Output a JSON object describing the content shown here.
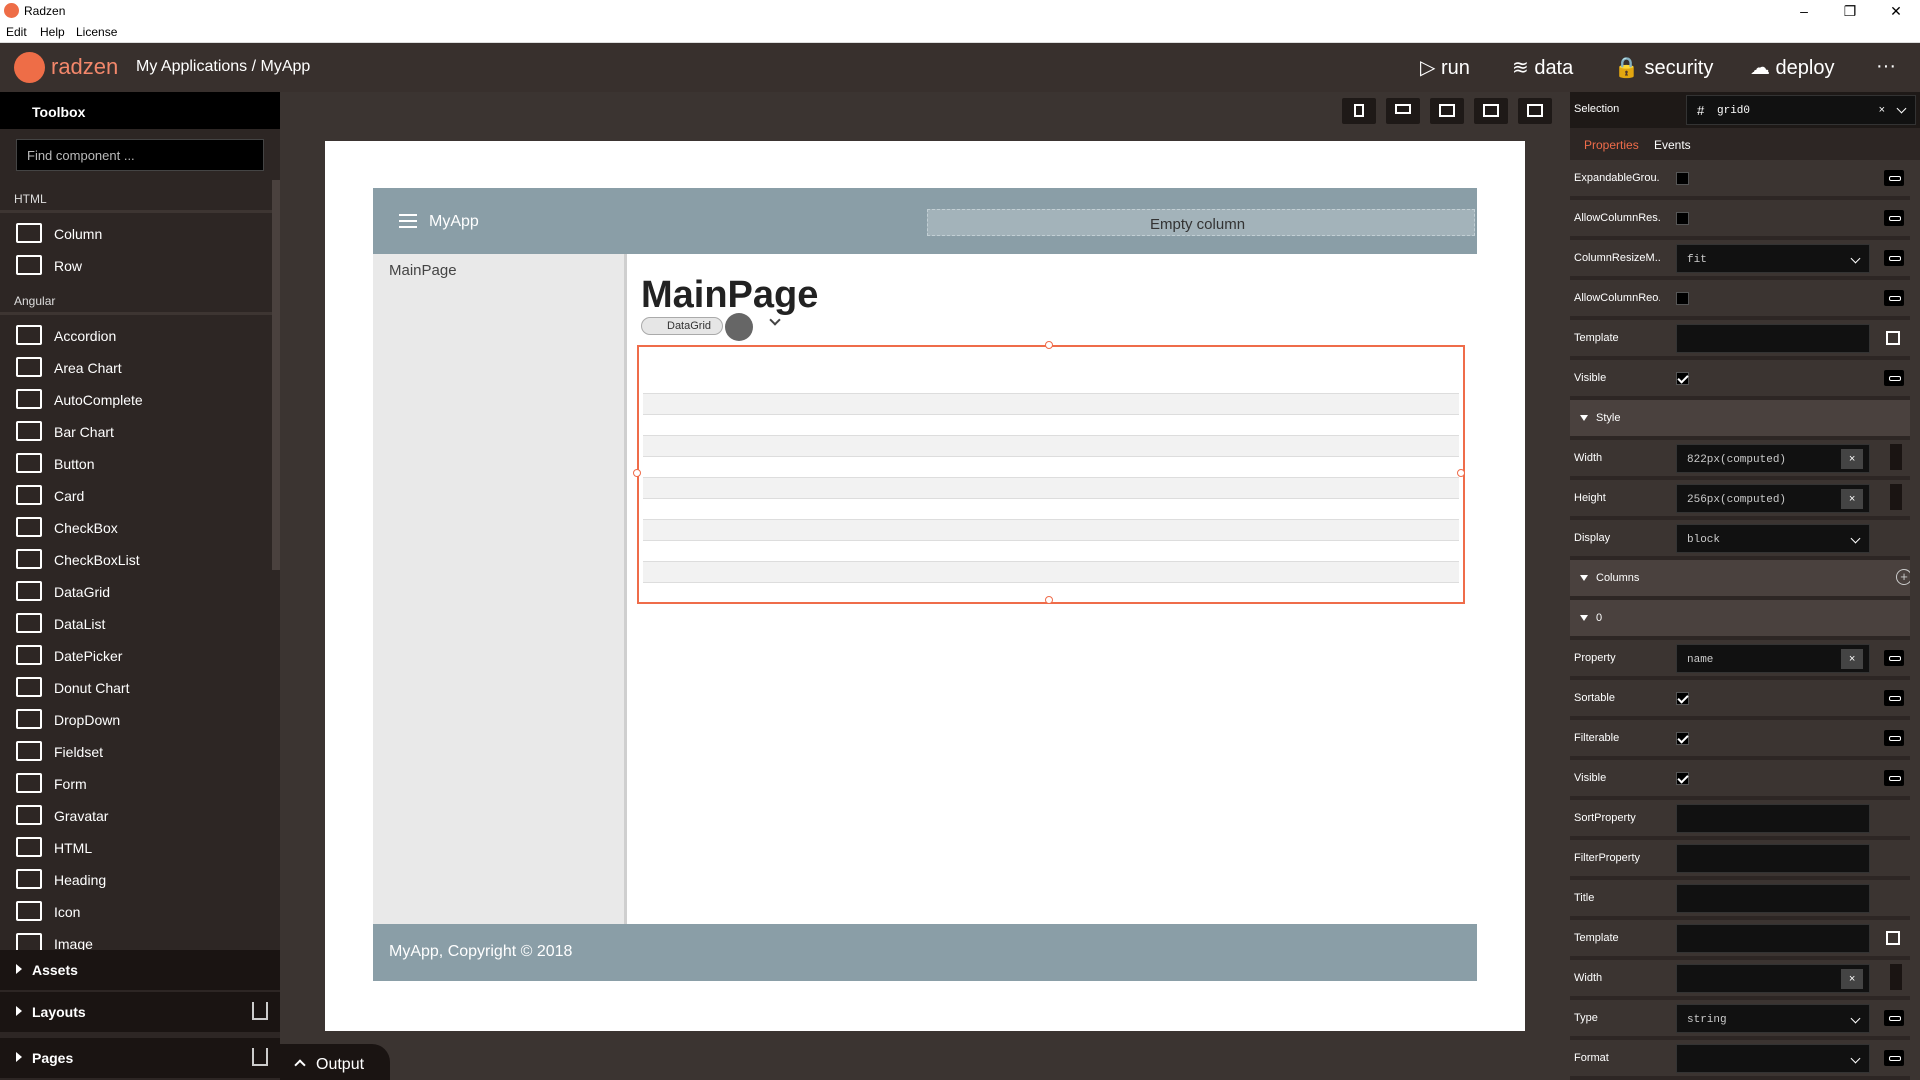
{
  "window": {
    "title": "Radzen",
    "min": "–",
    "max": "❐",
    "close": "✕"
  },
  "menu": [
    "Edit",
    "Help",
    "License"
  ],
  "appbar": {
    "brand": "radzen",
    "breadcrumb": "My Applications / MyApp",
    "nav": [
      {
        "label": "▷ run"
      },
      {
        "label": "≋ data"
      },
      {
        "label": "🔒 security"
      },
      {
        "label": "☁ deploy"
      }
    ],
    "more": "···"
  },
  "toolbox": {
    "title": "Toolbox",
    "search_placeholder": "Find component ...",
    "html_section": "HTML",
    "angular_section": "Angular",
    "html_items": [
      "Column",
      "Row"
    ],
    "angular_items": [
      "Accordion",
      "Area Chart",
      "AutoComplete",
      "Bar Chart",
      "Button",
      "Card",
      "CheckBox",
      "CheckBoxList",
      "DataGrid",
      "DataList",
      "DatePicker",
      "Donut Chart",
      "DropDown",
      "Fieldset",
      "Form",
      "Gravatar",
      "HTML",
      "Heading",
      "Icon",
      "Image"
    ],
    "footer": [
      "Assets",
      "Layouts",
      "Pages"
    ]
  },
  "canvas": {
    "app_name": "MyApp",
    "empty_column": "Empty column",
    "sidebar_link": "MainPage",
    "heading": "MainPage",
    "badge": "DataGrid",
    "footer": "MyApp, Copyright © 2018",
    "output": "Output"
  },
  "properties": {
    "selection_label": "Selection",
    "selection_value": "grid0",
    "tab_properties": "Properties",
    "tab_events": "Events",
    "rows": [
      {
        "label": "ExpandableGrou...",
        "type": "check",
        "checked": false
      },
      {
        "label": "AllowColumnRes...",
        "type": "check",
        "checked": false
      },
      {
        "label": "ColumnResizeM...",
        "type": "select",
        "value": "fit"
      },
      {
        "label": "AllowColumnReo...",
        "type": "check",
        "checked": false
      },
      {
        "label": "Template",
        "type": "template"
      },
      {
        "label": "Visible",
        "type": "check",
        "checked": true
      }
    ],
    "style_group": "Style",
    "style_rows": [
      {
        "label": "Width",
        "value": "822px(computed)"
      },
      {
        "label": "Height",
        "value": "256px(computed)"
      },
      {
        "label": "Display",
        "value": "block"
      }
    ],
    "columns_group": "Columns",
    "column_index": "0",
    "column_rows": [
      {
        "label": "Property",
        "value": "name"
      },
      {
        "label": "Sortable",
        "checked": true
      },
      {
        "label": "Filterable",
        "checked": true
      },
      {
        "label": "Visible",
        "checked": true
      },
      {
        "label": "SortProperty",
        "value": ""
      },
      {
        "label": "FilterProperty",
        "value": ""
      },
      {
        "label": "Title",
        "value": ""
      },
      {
        "label": "Template",
        "value": ""
      },
      {
        "label": "Width",
        "value": ""
      },
      {
        "label": "Type",
        "value": "string"
      },
      {
        "label": "Format",
        "value": ""
      }
    ]
  }
}
